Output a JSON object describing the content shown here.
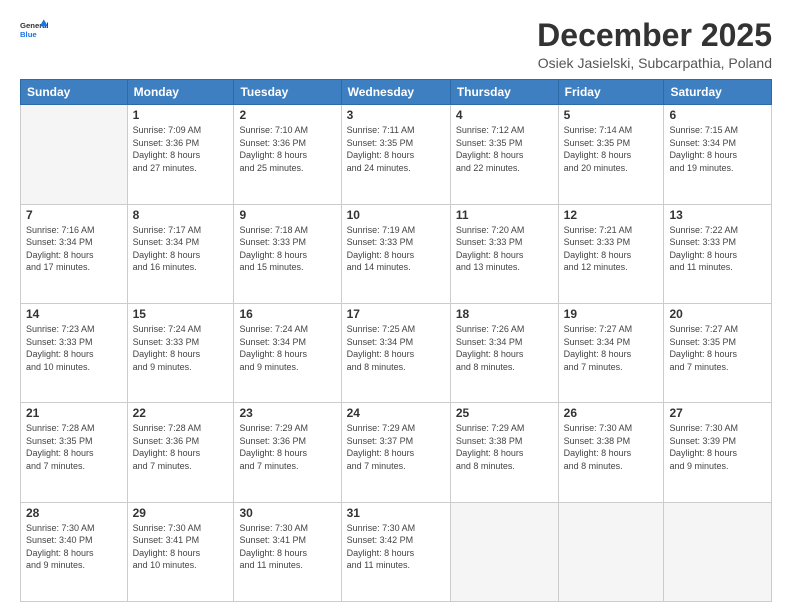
{
  "logo": {
    "line1": "General",
    "line2": "Blue"
  },
  "header": {
    "month": "December 2025",
    "location": "Osiek Jasielski, Subcarpathia, Poland"
  },
  "weekdays": [
    "Sunday",
    "Monday",
    "Tuesday",
    "Wednesday",
    "Thursday",
    "Friday",
    "Saturday"
  ],
  "weeks": [
    [
      {
        "day": "",
        "info": ""
      },
      {
        "day": "1",
        "info": "Sunrise: 7:09 AM\nSunset: 3:36 PM\nDaylight: 8 hours\nand 27 minutes."
      },
      {
        "day": "2",
        "info": "Sunrise: 7:10 AM\nSunset: 3:36 PM\nDaylight: 8 hours\nand 25 minutes."
      },
      {
        "day": "3",
        "info": "Sunrise: 7:11 AM\nSunset: 3:35 PM\nDaylight: 8 hours\nand 24 minutes."
      },
      {
        "day": "4",
        "info": "Sunrise: 7:12 AM\nSunset: 3:35 PM\nDaylight: 8 hours\nand 22 minutes."
      },
      {
        "day": "5",
        "info": "Sunrise: 7:14 AM\nSunset: 3:35 PM\nDaylight: 8 hours\nand 20 minutes."
      },
      {
        "day": "6",
        "info": "Sunrise: 7:15 AM\nSunset: 3:34 PM\nDaylight: 8 hours\nand 19 minutes."
      }
    ],
    [
      {
        "day": "7",
        "info": "Sunrise: 7:16 AM\nSunset: 3:34 PM\nDaylight: 8 hours\nand 17 minutes."
      },
      {
        "day": "8",
        "info": "Sunrise: 7:17 AM\nSunset: 3:34 PM\nDaylight: 8 hours\nand 16 minutes."
      },
      {
        "day": "9",
        "info": "Sunrise: 7:18 AM\nSunset: 3:33 PM\nDaylight: 8 hours\nand 15 minutes."
      },
      {
        "day": "10",
        "info": "Sunrise: 7:19 AM\nSunset: 3:33 PM\nDaylight: 8 hours\nand 14 minutes."
      },
      {
        "day": "11",
        "info": "Sunrise: 7:20 AM\nSunset: 3:33 PM\nDaylight: 8 hours\nand 13 minutes."
      },
      {
        "day": "12",
        "info": "Sunrise: 7:21 AM\nSunset: 3:33 PM\nDaylight: 8 hours\nand 12 minutes."
      },
      {
        "day": "13",
        "info": "Sunrise: 7:22 AM\nSunset: 3:33 PM\nDaylight: 8 hours\nand 11 minutes."
      }
    ],
    [
      {
        "day": "14",
        "info": "Sunrise: 7:23 AM\nSunset: 3:33 PM\nDaylight: 8 hours\nand 10 minutes."
      },
      {
        "day": "15",
        "info": "Sunrise: 7:24 AM\nSunset: 3:33 PM\nDaylight: 8 hours\nand 9 minutes."
      },
      {
        "day": "16",
        "info": "Sunrise: 7:24 AM\nSunset: 3:34 PM\nDaylight: 8 hours\nand 9 minutes."
      },
      {
        "day": "17",
        "info": "Sunrise: 7:25 AM\nSunset: 3:34 PM\nDaylight: 8 hours\nand 8 minutes."
      },
      {
        "day": "18",
        "info": "Sunrise: 7:26 AM\nSunset: 3:34 PM\nDaylight: 8 hours\nand 8 minutes."
      },
      {
        "day": "19",
        "info": "Sunrise: 7:27 AM\nSunset: 3:34 PM\nDaylight: 8 hours\nand 7 minutes."
      },
      {
        "day": "20",
        "info": "Sunrise: 7:27 AM\nSunset: 3:35 PM\nDaylight: 8 hours\nand 7 minutes."
      }
    ],
    [
      {
        "day": "21",
        "info": "Sunrise: 7:28 AM\nSunset: 3:35 PM\nDaylight: 8 hours\nand 7 minutes."
      },
      {
        "day": "22",
        "info": "Sunrise: 7:28 AM\nSunset: 3:36 PM\nDaylight: 8 hours\nand 7 minutes."
      },
      {
        "day": "23",
        "info": "Sunrise: 7:29 AM\nSunset: 3:36 PM\nDaylight: 8 hours\nand 7 minutes."
      },
      {
        "day": "24",
        "info": "Sunrise: 7:29 AM\nSunset: 3:37 PM\nDaylight: 8 hours\nand 7 minutes."
      },
      {
        "day": "25",
        "info": "Sunrise: 7:29 AM\nSunset: 3:38 PM\nDaylight: 8 hours\nand 8 minutes."
      },
      {
        "day": "26",
        "info": "Sunrise: 7:30 AM\nSunset: 3:38 PM\nDaylight: 8 hours\nand 8 minutes."
      },
      {
        "day": "27",
        "info": "Sunrise: 7:30 AM\nSunset: 3:39 PM\nDaylight: 8 hours\nand 9 minutes."
      }
    ],
    [
      {
        "day": "28",
        "info": "Sunrise: 7:30 AM\nSunset: 3:40 PM\nDaylight: 8 hours\nand 9 minutes."
      },
      {
        "day": "29",
        "info": "Sunrise: 7:30 AM\nSunset: 3:41 PM\nDaylight: 8 hours\nand 10 minutes."
      },
      {
        "day": "30",
        "info": "Sunrise: 7:30 AM\nSunset: 3:41 PM\nDaylight: 8 hours\nand 11 minutes."
      },
      {
        "day": "31",
        "info": "Sunrise: 7:30 AM\nSunset: 3:42 PM\nDaylight: 8 hours\nand 11 minutes."
      },
      {
        "day": "",
        "info": ""
      },
      {
        "day": "",
        "info": ""
      },
      {
        "day": "",
        "info": ""
      }
    ]
  ]
}
